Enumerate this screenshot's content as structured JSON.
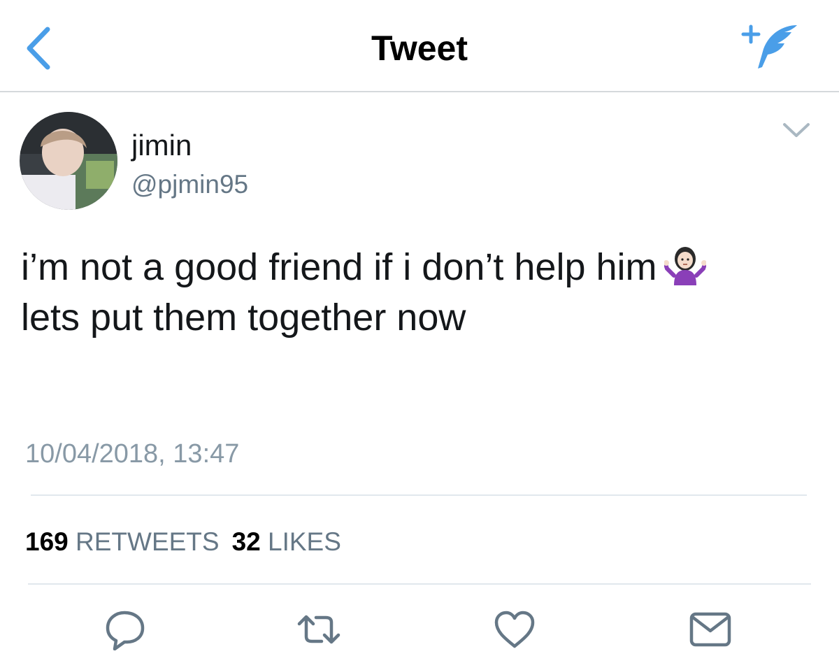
{
  "nav": {
    "title": "Tweet",
    "back_icon": "chevron-left-icon",
    "compose_icon": "compose-feather-icon",
    "accent": "#4a9ee8"
  },
  "tweet": {
    "author": {
      "display_name": "jimin",
      "username": "@pjmin95"
    },
    "text_line1": "i’m not a good friend if i don’t help him",
    "text_line2": "lets put them together now",
    "emoji": "person-shrugging",
    "timestamp": "10/04/2018, 13:47",
    "stats": {
      "retweets_count": "169",
      "retweets_label": "RETWEETS",
      "likes_count": "32",
      "likes_label": "LIKES"
    },
    "actions": [
      "reply-icon",
      "retweet-icon",
      "like-icon",
      "message-icon"
    ]
  },
  "colors": {
    "text_primary": "#14171a",
    "text_secondary": "#657786",
    "timestamp": "#8899a6",
    "divider": "#e1e8ed",
    "icon_gray": "#657786"
  }
}
